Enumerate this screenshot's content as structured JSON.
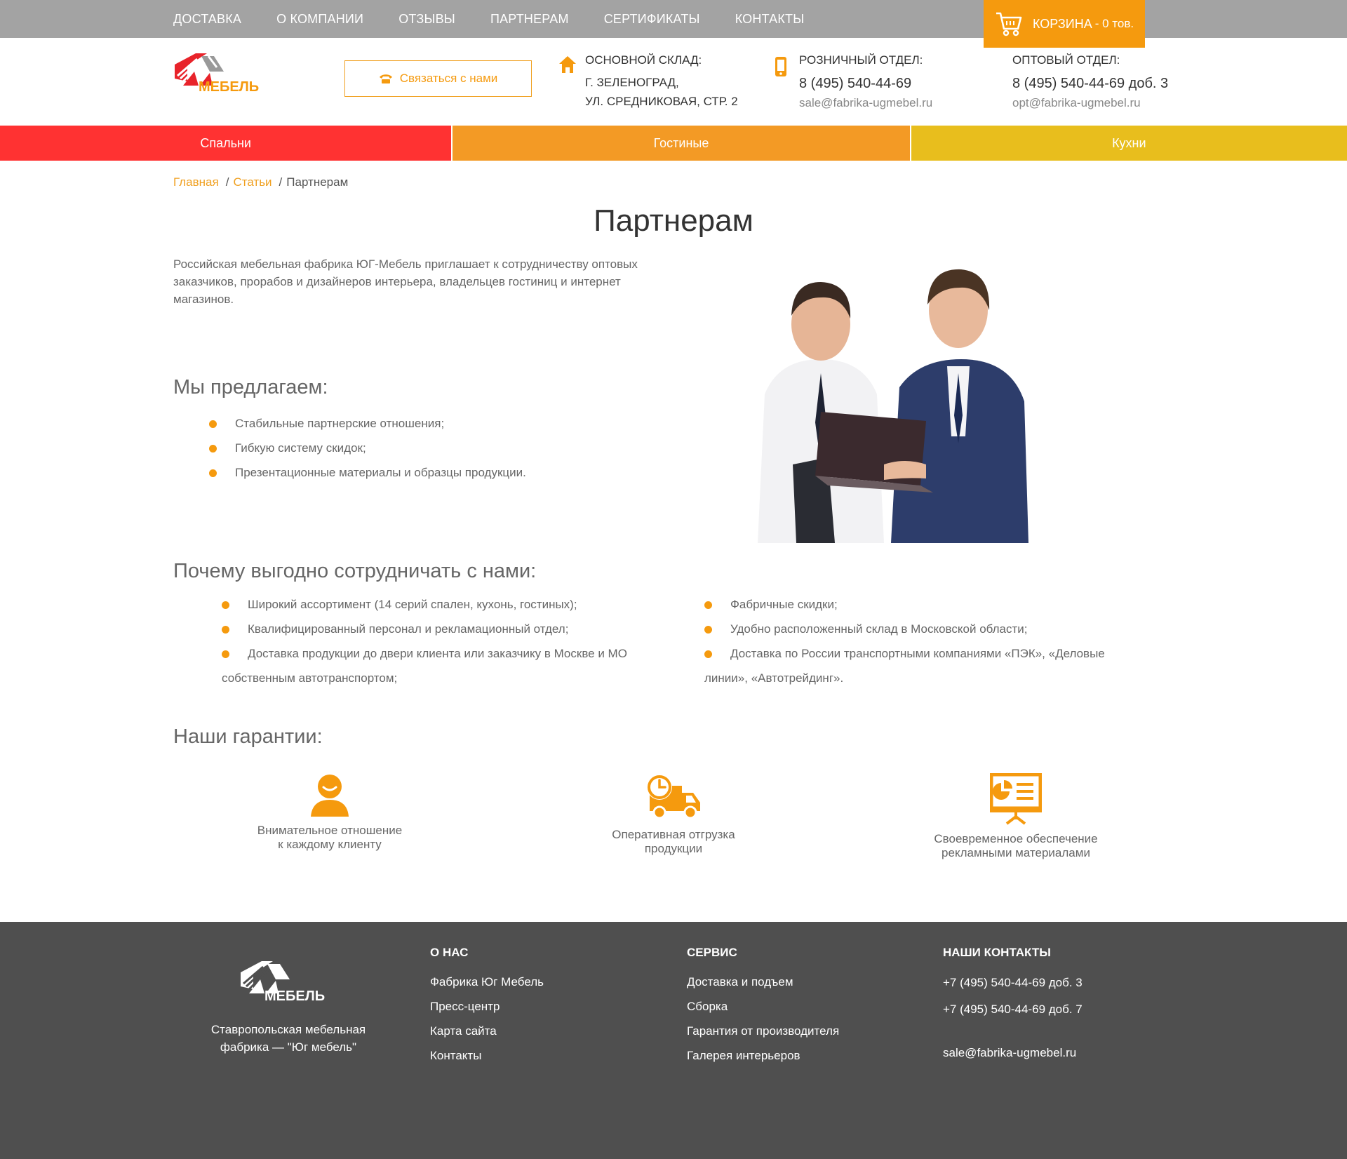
{
  "topnav": [
    "ДОСТАВКА",
    "О КОМПАНИИ",
    "ОТЗЫВЫ",
    "ПАРТНЕРАМ",
    "СЕРТИФИКАТЫ",
    "КОНТАКТЫ"
  ],
  "cart": {
    "label": "КОРЗИНА",
    "count": "- 0 тов."
  },
  "header": {
    "contact_button": "Связаться с нами",
    "warehouse": {
      "label": "ОСНОВНОЙ СКЛАД:",
      "line1": "Г. ЗЕЛЕНОГРАД,",
      "line2": "УЛ. СРЕДНИКОВАЯ, СТР. 2"
    },
    "retail": {
      "label": "РОЗНИЧНЫЙ ОТДЕЛ:",
      "phone": "8 (495) 540-44-69",
      "email": "sale@fabrika-ugmebel.ru"
    },
    "wholesale": {
      "label": "ОПТОВЫЙ ОТДЕЛ:",
      "phone": "8 (495) 540-44-69 доб. 3",
      "email": "opt@fabrika-ugmebel.ru"
    }
  },
  "categories": [
    "Спальни",
    "Гостиные",
    "Кухни"
  ],
  "breadcrumb": {
    "home": "Главная",
    "articles": "Статьи",
    "current": "Партнерам"
  },
  "page_title": "Партнерам",
  "intro": "Российская мебельная фабрика ЮГ-Мебель приглашает к сотрудничеству оптовых заказчиков, прорабов и дизайнеров интерьера, владельцев гостиниц и интернет магазинов.",
  "offer": {
    "heading": "Мы предлагаем:",
    "items": [
      "Стабильные партнерские отношения;",
      "Гибкую систему скидок;",
      "Презентационные материалы и образцы продукции."
    ]
  },
  "why": {
    "heading": "Почему выгодно сотрудничать с нами:",
    "left": [
      "Широкий ассортимент (14 серий спален, кухонь, гостиных);",
      "Квалифицированный персонал и рекламационный отдел;",
      "Доставка продукции до двери клиента или заказчику в Москве и МО собственным автотранспортом;"
    ],
    "right": [
      "Фабричные скидки;",
      "Удобно расположенный склад в Московской области;",
      "Доставка по России транспортными компаниями «ПЭК», «Деловые линии», «Автотрейдинг»."
    ]
  },
  "guarantees": {
    "heading": "Наши гарантии:",
    "items": [
      {
        "line1": "Внимательное отношение",
        "line2": "к каждому клиенту",
        "icon": "person-icon"
      },
      {
        "line1": "Оперативная отгрузка",
        "line2": "продукции",
        "icon": "delivery-truck-icon"
      },
      {
        "line1": "Своевременное обеспечение",
        "line2": "рекламными материалами",
        "icon": "presentation-board-icon"
      }
    ]
  },
  "footer": {
    "description_line1": "Ставропольская мебельная",
    "description_line2": "фабрика — \"Юг мебель\"",
    "about": {
      "heading": "О НАС",
      "links": [
        "Фабрика Юг Мебель",
        "Пресс-центр",
        "Карта сайта",
        "Контакты"
      ]
    },
    "service": {
      "heading": "СЕРВИС",
      "links": [
        "Доставка и подъем",
        "Сборка",
        "Гарантия от производителя",
        "Галерея интерьеров"
      ]
    },
    "contacts": {
      "heading": "НАШИ КОНТАКТЫ",
      "phone1": "+7 (495) 540-44-69 доб. 3",
      "phone2": "+7 (495) 540-44-69 доб. 7",
      "email": "sale@fabrika-ugmebel.ru"
    }
  },
  "colors": {
    "accent": "#f59a0e",
    "red": "#ff3232",
    "orange": "#f39a25",
    "yellow": "#e8be1d",
    "topbar": "#a3a3a3",
    "footer": "#4f4f4f"
  }
}
